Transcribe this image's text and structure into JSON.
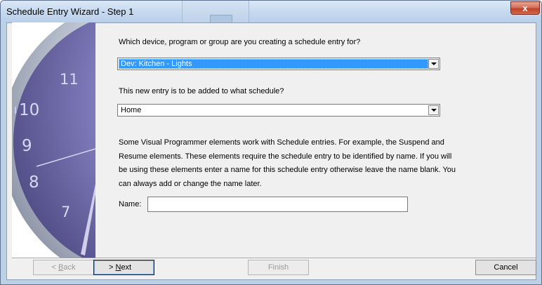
{
  "window": {
    "title": "Schedule Entry Wizard - Step 1",
    "close_symbol": "x"
  },
  "side_art": {
    "icon": "clock-face-icon",
    "numbers": [
      "11",
      "10",
      "9",
      "8",
      "7"
    ]
  },
  "step1": {
    "device_question": "Which device, program or group are you creating a schedule entry for?",
    "device_value": "Dev: Kitchen - Lights",
    "schedule_question": "This new entry is to be added to what schedule?",
    "schedule_value": "Home",
    "description_lines": [
      "Some Visual Programmer elements work with Schedule entries.  For example, the Suspend and",
      "Resume elements.  These elements require the schedule entry to be identified by name.  If you will",
      "be using these elements enter a name for this schedule entry otherwise leave the name blank.  You",
      "can always add or change the name later."
    ],
    "name_label": "Name:",
    "name_value": ""
  },
  "buttons": {
    "back_prefix": "< ",
    "back_key": "B",
    "back_rest": "ack",
    "next_prefix": "> ",
    "next_key": "N",
    "next_rest": "ext",
    "finish": "Finish",
    "cancel": "Cancel"
  },
  "colors": {
    "selection": "#3399ff",
    "clock_face": "#8d89c7",
    "titlebar": "#c6d9ef"
  }
}
